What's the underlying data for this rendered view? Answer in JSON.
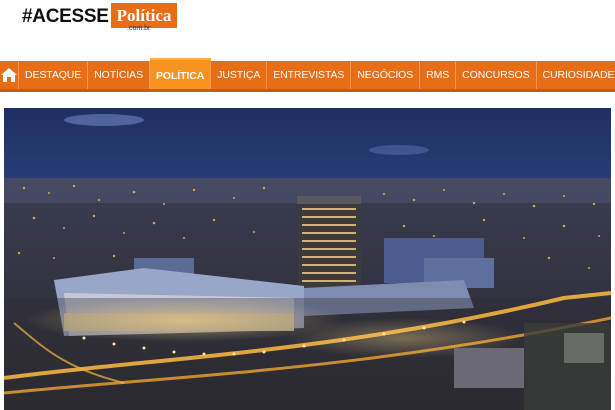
{
  "logo": {
    "hash_text": "#ACESSE",
    "brand_text": "Política",
    "domain_text": ".com.br"
  },
  "nav": {
    "home_icon": "home-icon",
    "items": [
      {
        "label": "DESTAQUE",
        "active": false
      },
      {
        "label": "NOTÍCIAS",
        "active": false
      },
      {
        "label": "POLÍTICA",
        "active": true
      },
      {
        "label": "JUSTIÇA",
        "active": false
      },
      {
        "label": "ENTREVISTAS",
        "active": false
      },
      {
        "label": "NEGÓCIOS",
        "active": false
      },
      {
        "label": "RMS",
        "active": false
      },
      {
        "label": "CONCURSOS",
        "active": false
      },
      {
        "label": "CURIOSIDADES",
        "active": false
      }
    ]
  },
  "colors": {
    "brand_orange": "#e76d17",
    "active_orange": "#f7931e",
    "sky_dark": "#2b3f7a",
    "city_lights": "#f2b552"
  }
}
